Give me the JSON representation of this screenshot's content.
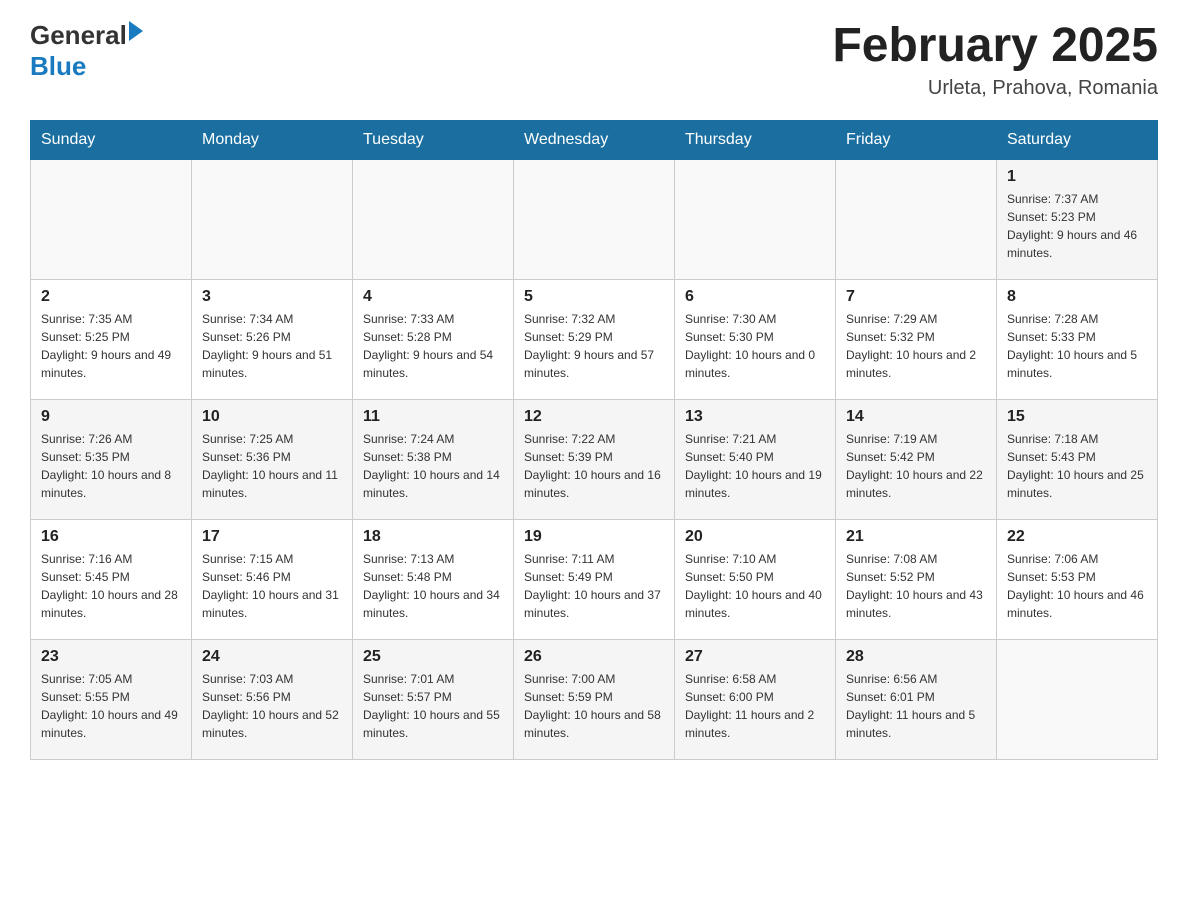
{
  "header": {
    "logo_general": "General",
    "logo_blue": "Blue",
    "month": "February 2025",
    "location": "Urleta, Prahova, Romania"
  },
  "weekdays": [
    "Sunday",
    "Monday",
    "Tuesday",
    "Wednesday",
    "Thursday",
    "Friday",
    "Saturday"
  ],
  "weeks": [
    [
      {
        "day": "",
        "info": ""
      },
      {
        "day": "",
        "info": ""
      },
      {
        "day": "",
        "info": ""
      },
      {
        "day": "",
        "info": ""
      },
      {
        "day": "",
        "info": ""
      },
      {
        "day": "",
        "info": ""
      },
      {
        "day": "1",
        "info": "Sunrise: 7:37 AM\nSunset: 5:23 PM\nDaylight: 9 hours and 46 minutes."
      }
    ],
    [
      {
        "day": "2",
        "info": "Sunrise: 7:35 AM\nSunset: 5:25 PM\nDaylight: 9 hours and 49 minutes."
      },
      {
        "day": "3",
        "info": "Sunrise: 7:34 AM\nSunset: 5:26 PM\nDaylight: 9 hours and 51 minutes."
      },
      {
        "day": "4",
        "info": "Sunrise: 7:33 AM\nSunset: 5:28 PM\nDaylight: 9 hours and 54 minutes."
      },
      {
        "day": "5",
        "info": "Sunrise: 7:32 AM\nSunset: 5:29 PM\nDaylight: 9 hours and 57 minutes."
      },
      {
        "day": "6",
        "info": "Sunrise: 7:30 AM\nSunset: 5:30 PM\nDaylight: 10 hours and 0 minutes."
      },
      {
        "day": "7",
        "info": "Sunrise: 7:29 AM\nSunset: 5:32 PM\nDaylight: 10 hours and 2 minutes."
      },
      {
        "day": "8",
        "info": "Sunrise: 7:28 AM\nSunset: 5:33 PM\nDaylight: 10 hours and 5 minutes."
      }
    ],
    [
      {
        "day": "9",
        "info": "Sunrise: 7:26 AM\nSunset: 5:35 PM\nDaylight: 10 hours and 8 minutes."
      },
      {
        "day": "10",
        "info": "Sunrise: 7:25 AM\nSunset: 5:36 PM\nDaylight: 10 hours and 11 minutes."
      },
      {
        "day": "11",
        "info": "Sunrise: 7:24 AM\nSunset: 5:38 PM\nDaylight: 10 hours and 14 minutes."
      },
      {
        "day": "12",
        "info": "Sunrise: 7:22 AM\nSunset: 5:39 PM\nDaylight: 10 hours and 16 minutes."
      },
      {
        "day": "13",
        "info": "Sunrise: 7:21 AM\nSunset: 5:40 PM\nDaylight: 10 hours and 19 minutes."
      },
      {
        "day": "14",
        "info": "Sunrise: 7:19 AM\nSunset: 5:42 PM\nDaylight: 10 hours and 22 minutes."
      },
      {
        "day": "15",
        "info": "Sunrise: 7:18 AM\nSunset: 5:43 PM\nDaylight: 10 hours and 25 minutes."
      }
    ],
    [
      {
        "day": "16",
        "info": "Sunrise: 7:16 AM\nSunset: 5:45 PM\nDaylight: 10 hours and 28 minutes."
      },
      {
        "day": "17",
        "info": "Sunrise: 7:15 AM\nSunset: 5:46 PM\nDaylight: 10 hours and 31 minutes."
      },
      {
        "day": "18",
        "info": "Sunrise: 7:13 AM\nSunset: 5:48 PM\nDaylight: 10 hours and 34 minutes."
      },
      {
        "day": "19",
        "info": "Sunrise: 7:11 AM\nSunset: 5:49 PM\nDaylight: 10 hours and 37 minutes."
      },
      {
        "day": "20",
        "info": "Sunrise: 7:10 AM\nSunset: 5:50 PM\nDaylight: 10 hours and 40 minutes."
      },
      {
        "day": "21",
        "info": "Sunrise: 7:08 AM\nSunset: 5:52 PM\nDaylight: 10 hours and 43 minutes."
      },
      {
        "day": "22",
        "info": "Sunrise: 7:06 AM\nSunset: 5:53 PM\nDaylight: 10 hours and 46 minutes."
      }
    ],
    [
      {
        "day": "23",
        "info": "Sunrise: 7:05 AM\nSunset: 5:55 PM\nDaylight: 10 hours and 49 minutes."
      },
      {
        "day": "24",
        "info": "Sunrise: 7:03 AM\nSunset: 5:56 PM\nDaylight: 10 hours and 52 minutes."
      },
      {
        "day": "25",
        "info": "Sunrise: 7:01 AM\nSunset: 5:57 PM\nDaylight: 10 hours and 55 minutes."
      },
      {
        "day": "26",
        "info": "Sunrise: 7:00 AM\nSunset: 5:59 PM\nDaylight: 10 hours and 58 minutes."
      },
      {
        "day": "27",
        "info": "Sunrise: 6:58 AM\nSunset: 6:00 PM\nDaylight: 11 hours and 2 minutes."
      },
      {
        "day": "28",
        "info": "Sunrise: 6:56 AM\nSunset: 6:01 PM\nDaylight: 11 hours and 5 minutes."
      },
      {
        "day": "",
        "info": ""
      }
    ]
  ]
}
